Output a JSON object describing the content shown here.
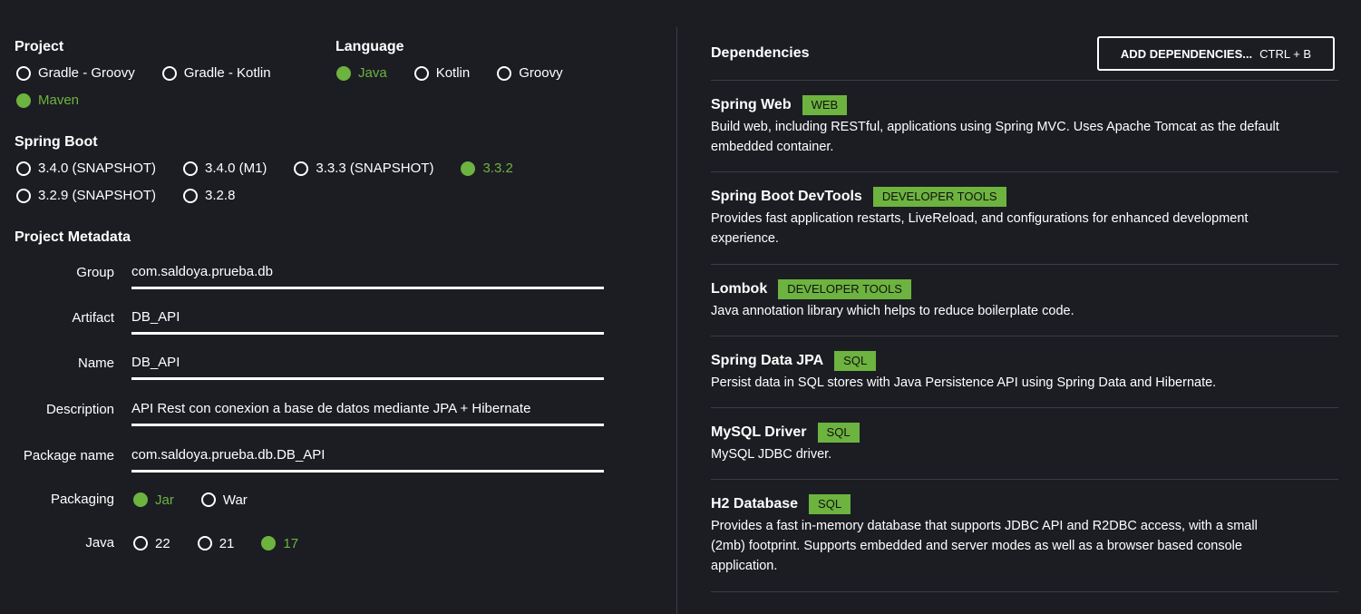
{
  "project": {
    "title": "Project",
    "options": [
      "Gradle - Groovy",
      "Gradle - Kotlin",
      "Maven"
    ],
    "selected": "Maven"
  },
  "language": {
    "title": "Language",
    "options": [
      "Java",
      "Kotlin",
      "Groovy"
    ],
    "selected": "Java"
  },
  "spring_boot": {
    "title": "Spring Boot",
    "options": [
      "3.4.0 (SNAPSHOT)",
      "3.4.0 (M1)",
      "3.3.3 (SNAPSHOT)",
      "3.3.2",
      "3.2.9 (SNAPSHOT)",
      "3.2.8"
    ],
    "selected": "3.3.2"
  },
  "metadata": {
    "title": "Project Metadata",
    "group": {
      "label": "Group",
      "value": "com.saldoya.prueba.db"
    },
    "artifact": {
      "label": "Artifact",
      "value": "DB_API"
    },
    "name": {
      "label": "Name",
      "value": "DB_API"
    },
    "description": {
      "label": "Description",
      "value": "API Rest con conexion a base de datos mediante JPA + Hibernate"
    },
    "package_name": {
      "label": "Package name",
      "value": "com.saldoya.prueba.db.DB_API"
    },
    "packaging": {
      "label": "Packaging",
      "options": [
        "Jar",
        "War"
      ],
      "selected": "Jar"
    },
    "java": {
      "label": "Java",
      "options": [
        "22",
        "21",
        "17"
      ],
      "selected": "17"
    }
  },
  "dependencies": {
    "title": "Dependencies",
    "add_button": {
      "label": "ADD DEPENDENCIES...",
      "shortcut": "CTRL + B"
    },
    "items": [
      {
        "name": "Spring Web",
        "badge": "WEB",
        "description": "Build web, including RESTful, applications using Spring MVC. Uses Apache Tomcat as the default embedded container."
      },
      {
        "name": "Spring Boot DevTools",
        "badge": "DEVELOPER TOOLS",
        "description": "Provides fast application restarts, LiveReload, and configurations for enhanced development experience."
      },
      {
        "name": "Lombok",
        "badge": "DEVELOPER TOOLS",
        "description": "Java annotation library which helps to reduce boilerplate code."
      },
      {
        "name": "Spring Data JPA",
        "badge": "SQL",
        "description": "Persist data in SQL stores with Java Persistence API using Spring Data and Hibernate."
      },
      {
        "name": "MySQL Driver",
        "badge": "SQL",
        "description": "MySQL JDBC driver."
      },
      {
        "name": "H2 Database",
        "badge": "SQL",
        "description": "Provides a fast in-memory database that supports JDBC API and R2DBC access, with a small (2mb) footprint. Supports embedded and server modes as well as a browser based console application."
      }
    ]
  },
  "colors": {
    "accent": "#6db33f",
    "background": "#1b1d23",
    "divider": "#3a3d45"
  }
}
